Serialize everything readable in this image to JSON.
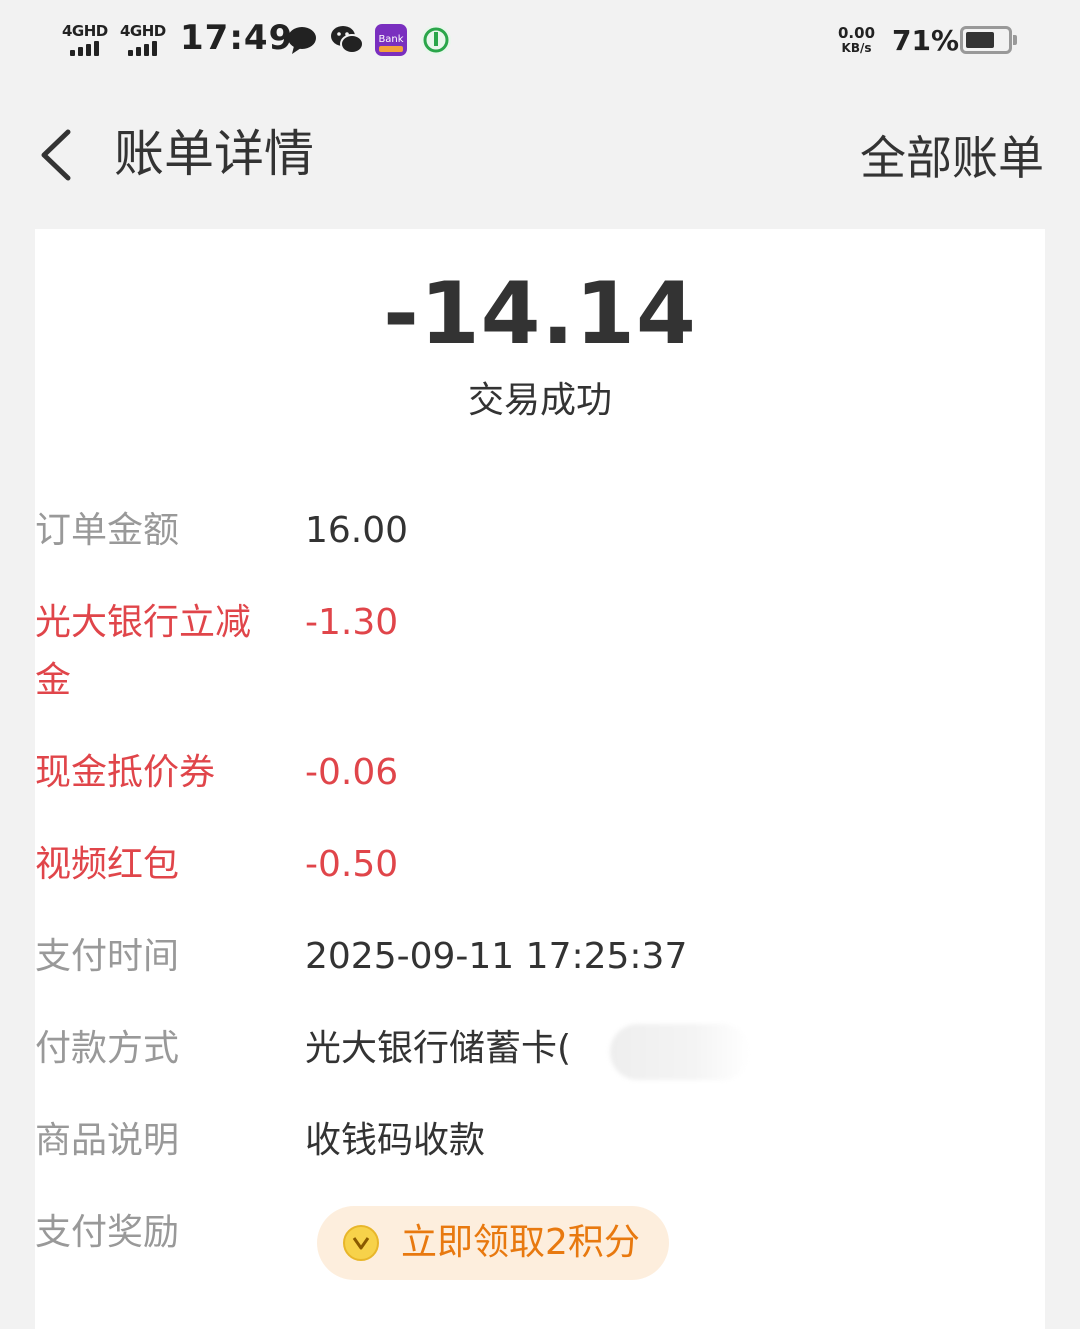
{
  "status_bar": {
    "signal1": "4GHD",
    "signal2": "4GHD",
    "time": "17:49",
    "net_speed_value": "0.00",
    "net_speed_unit": "KB/s",
    "battery_percent": "71%",
    "battery_level": 0.71,
    "icons": [
      "chat-bubble-icon",
      "wechat-icon",
      "bank-app-icon",
      "green-app-icon"
    ]
  },
  "nav": {
    "title": "账单详情",
    "right_action": "全部账单"
  },
  "summary": {
    "amount": "-14.14",
    "status": "交易成功"
  },
  "details": [
    {
      "key": "订单金额",
      "value": "16.00"
    },
    {
      "key": "光大银行立减金",
      "value": "-1.30"
    },
    {
      "key": "现金抵价券",
      "value": "-0.06"
    },
    {
      "key": "视频红包",
      "value": "-0.50"
    },
    {
      "key": "支付时间",
      "value": "2025-09-11 17:25:37"
    },
    {
      "key": "付款方式",
      "value": "光大银行储蓄卡("
    },
    {
      "key": "商品说明",
      "value": "收钱码收款"
    },
    {
      "key": "支付奖励",
      "value": ""
    }
  ],
  "reward": {
    "label": "立即领取2积分"
  },
  "colors": {
    "accent_red": "#e0454a",
    "reward_text": "#e8790f",
    "reward_bg": "#fdeedd",
    "page_bg": "#f2f2f2"
  }
}
